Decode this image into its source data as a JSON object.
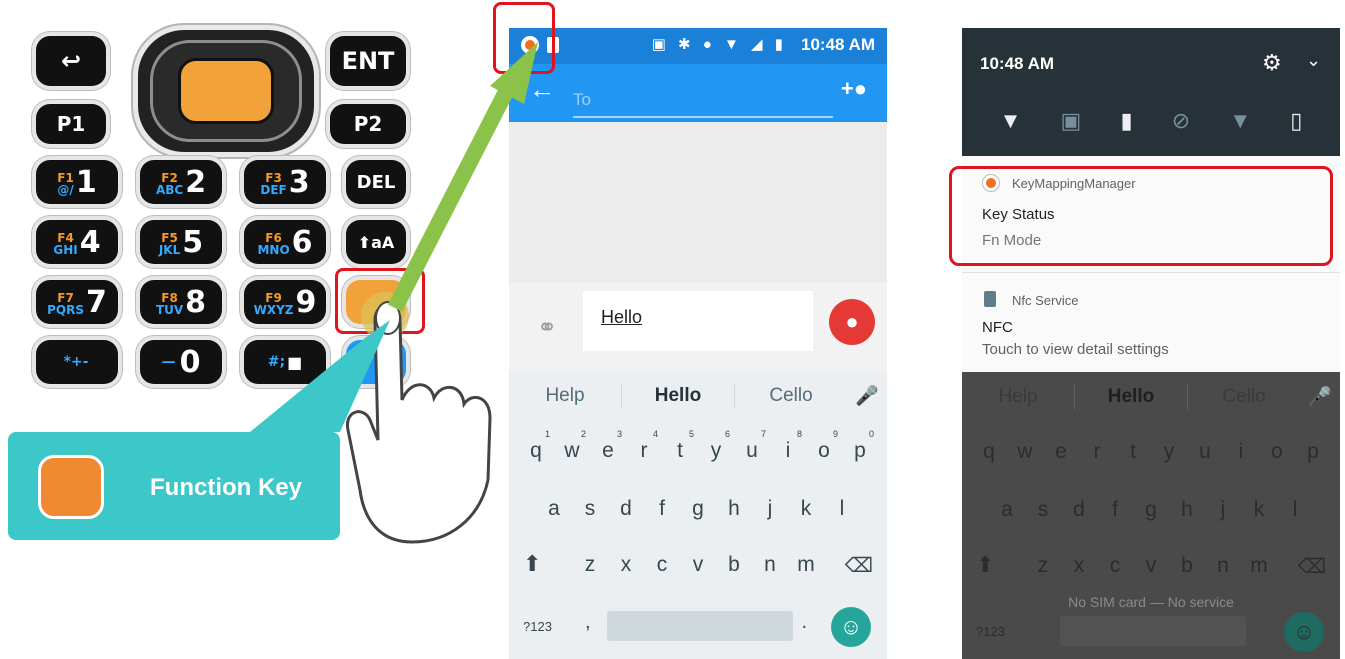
{
  "keypad": {
    "back_icon": "back-arrow-icon",
    "ent": "ENT",
    "p1": "P1",
    "p2": "P2",
    "del": "DEL",
    "shift_label": "aA",
    "keys": [
      {
        "f": "F1",
        "letters": "@/",
        "digit": "1"
      },
      {
        "f": "F2",
        "letters": "ABC",
        "digit": "2"
      },
      {
        "f": "F3",
        "letters": "DEF",
        "digit": "3"
      },
      {
        "f": "F4",
        "letters": "GHI",
        "digit": "4"
      },
      {
        "f": "F5",
        "letters": "JKL",
        "digit": "5"
      },
      {
        "f": "F6",
        "letters": "MNO",
        "digit": "6"
      },
      {
        "f": "F7",
        "letters": "PQRS",
        "digit": "7"
      },
      {
        "f": "F8",
        "letters": "TUV",
        "digit": "8"
      },
      {
        "f": "F9",
        "letters": "WXYZ",
        "digit": "9"
      }
    ],
    "bottom": {
      "star": "*+-",
      "zero_sym": "—",
      "zero": "0",
      "hash": "#;"
    },
    "callout_label": "Function Key",
    "function_key_color": "#f08a32"
  },
  "phone1": {
    "status_icons": "▣ ✱ ● ▼ ◢ ▮",
    "time": "10:48 AM",
    "to_placeholder": "To",
    "message_text": "Hello",
    "suggestions": [
      "Help",
      "Hello",
      "Cello"
    ],
    "rows": [
      [
        "q",
        "w",
        "e",
        "r",
        "t",
        "y",
        "u",
        "i",
        "o",
        "p"
      ],
      [
        "a",
        "s",
        "d",
        "f",
        "g",
        "h",
        "j",
        "k",
        "l"
      ],
      [
        "z",
        "x",
        "c",
        "v",
        "b",
        "n",
        "m"
      ]
    ],
    "numbers": [
      "1",
      "2",
      "3",
      "4",
      "5",
      "6",
      "7",
      "8",
      "9",
      "0"
    ],
    "sym_key": "?123",
    "comma": ",",
    "period": ".",
    "accent_color": "#2196f3"
  },
  "phone2": {
    "time": "10:48 AM",
    "notif1": {
      "app": "KeyMappingManager",
      "title": "Key Status",
      "text": "Fn Mode"
    },
    "notif2": {
      "app": "Nfc Service",
      "title": "NFC",
      "text": "Touch to view detail settings"
    },
    "no_sim": "No SIM card — No service",
    "sym_key": "?123"
  }
}
